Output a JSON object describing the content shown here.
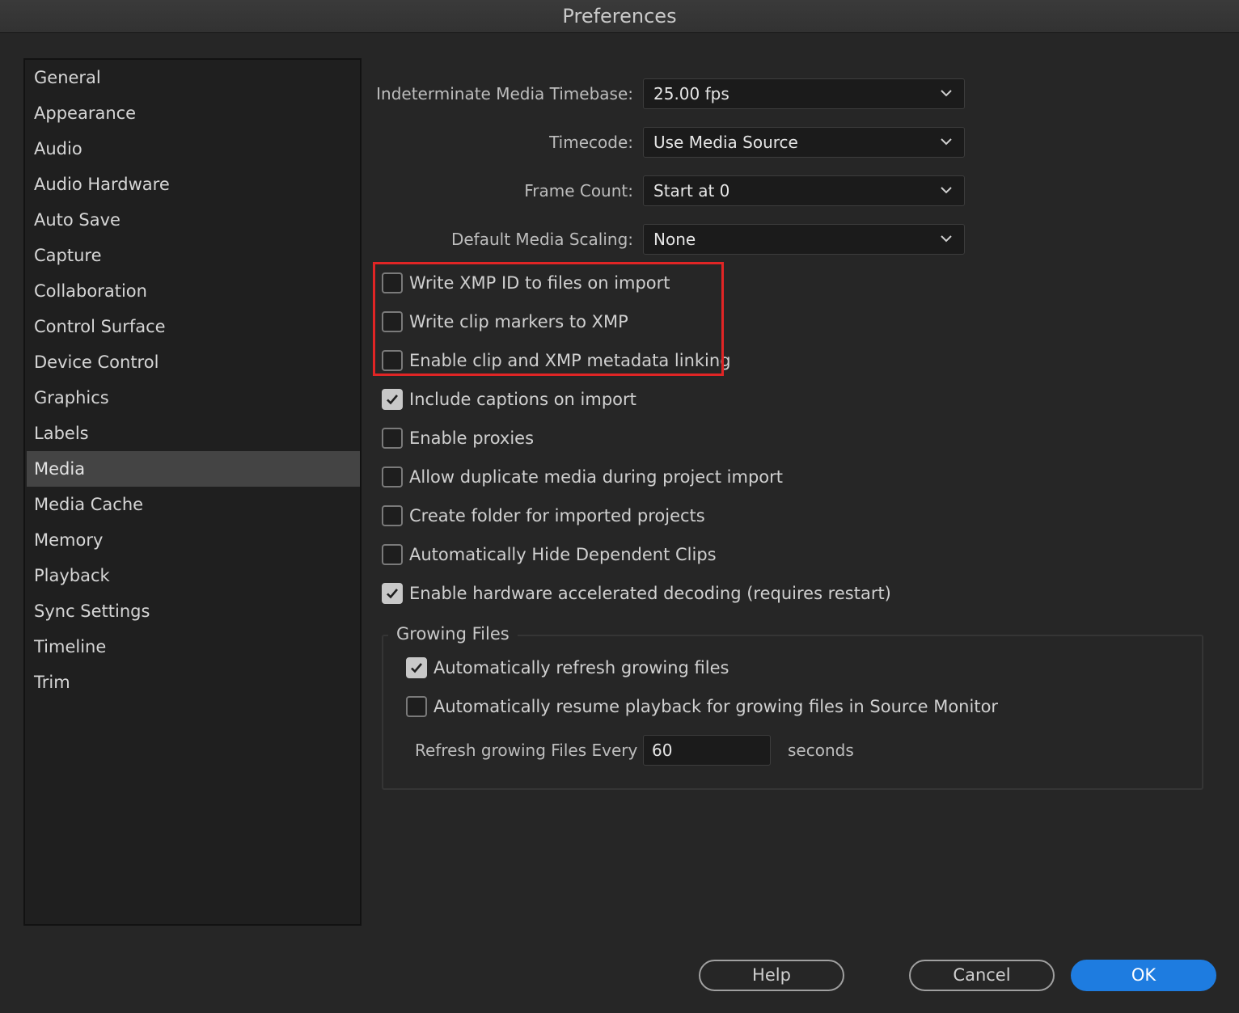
{
  "window": {
    "title": "Preferences"
  },
  "sidebar": {
    "selected": "Media",
    "items": [
      "General",
      "Appearance",
      "Audio",
      "Audio Hardware",
      "Auto Save",
      "Capture",
      "Collaboration",
      "Control Surface",
      "Device Control",
      "Graphics",
      "Labels",
      "Media",
      "Media Cache",
      "Memory",
      "Playback",
      "Sync Settings",
      "Timeline",
      "Trim"
    ]
  },
  "fields": {
    "timebase": {
      "label": "Indeterminate Media Timebase:",
      "value": "25.00 fps"
    },
    "timecode": {
      "label": "Timecode:",
      "value": "Use Media Source"
    },
    "frame_count": {
      "label": "Frame Count:",
      "value": "Start at 0"
    },
    "scaling": {
      "label": "Default Media Scaling:",
      "value": "None"
    }
  },
  "checkboxes": {
    "write_xmp_id": {
      "label": "Write XMP ID to files on import",
      "checked": false
    },
    "write_clip_markers": {
      "label": "Write clip markers to XMP",
      "checked": false
    },
    "enable_xmp_linking": {
      "label": "Enable clip and XMP metadata linking",
      "checked": false
    },
    "include_captions": {
      "label": "Include captions on import",
      "checked": true
    },
    "enable_proxies": {
      "label": "Enable proxies",
      "checked": false
    },
    "allow_duplicate": {
      "label": "Allow duplicate media during project import",
      "checked": false
    },
    "create_folder": {
      "label": "Create folder for imported projects",
      "checked": false
    },
    "hide_dependent": {
      "label": "Automatically Hide Dependent Clips",
      "checked": false
    },
    "hw_decoding": {
      "label": "Enable hardware accelerated decoding (requires restart)",
      "checked": true
    }
  },
  "growing_files": {
    "title": "Growing Files",
    "auto_refresh": {
      "label": "Automatically refresh growing files",
      "checked": true
    },
    "auto_resume": {
      "label": "Automatically resume playback for growing files in Source Monitor",
      "checked": false
    },
    "refresh_label": "Refresh growing Files Every",
    "refresh_value": "60",
    "refresh_unit": "seconds"
  },
  "buttons": {
    "help": "Help",
    "cancel": "Cancel",
    "ok": "OK"
  },
  "colors": {
    "accent": "#1e7ce0",
    "highlight": "#e02525",
    "background": "#262626"
  }
}
